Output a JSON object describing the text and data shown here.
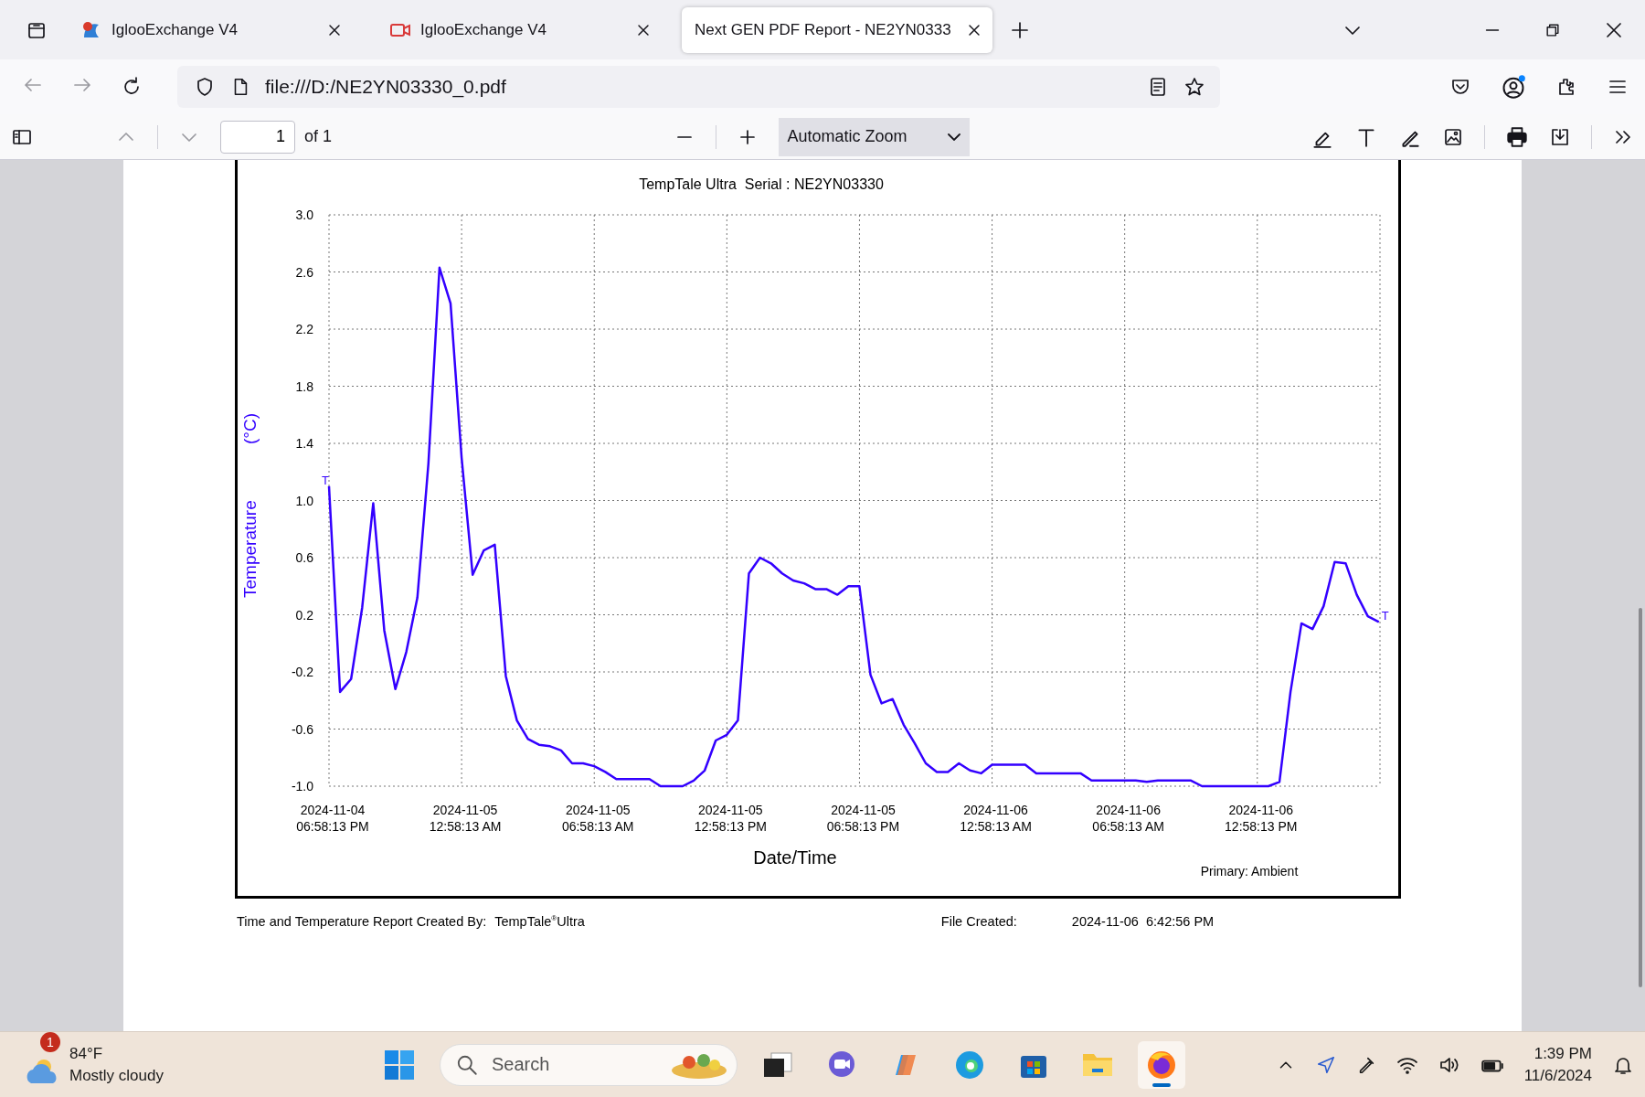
{
  "browser": {
    "tabs": [
      {
        "title": "IglooExchange V4",
        "kind": "logo",
        "selected": false
      },
      {
        "title": "IglooExchange V4",
        "kind": "video",
        "selected": false
      },
      {
        "title": "Next GEN PDF Report - NE2YN0333",
        "kind": "none",
        "selected": true
      }
    ],
    "address_bar": {
      "url": "file:///D:/NE2YN03330_0.pdf"
    }
  },
  "pdf_toolbar": {
    "page_number": "1",
    "page_count": "of 1",
    "zoom": "Automatic Zoom"
  },
  "report": {
    "chart_data": {
      "type": "line",
      "title": "TempTale Ultra  Serial : NE2YN03330",
      "xlabel": "Date/Time",
      "ylabel": "Temperature (°C)",
      "categories": [
        "2024-11-04 06:58:13 PM",
        null,
        null,
        null,
        null,
        null,
        null,
        null,
        null,
        null,
        null,
        null,
        "2024-11-05 12:58:13 AM",
        null,
        null,
        null,
        null,
        null,
        null,
        null,
        null,
        null,
        null,
        null,
        "2024-11-05 06:58:13 AM",
        null,
        null,
        null,
        null,
        null,
        null,
        null,
        null,
        null,
        null,
        null,
        "2024-11-05 12:58:13 PM",
        null,
        null,
        null,
        null,
        null,
        null,
        null,
        null,
        null,
        null,
        null,
        "2024-11-05 06:58:13 PM",
        null,
        null,
        null,
        null,
        null,
        null,
        null,
        null,
        null,
        null,
        null,
        "2024-11-06 12:58:13 AM",
        null,
        null,
        null,
        null,
        null,
        null,
        null,
        null,
        null,
        null,
        null,
        "2024-11-06 06:58:13 AM",
        null,
        null,
        null,
        null,
        null,
        null,
        null,
        null,
        null,
        null,
        null,
        "2024-11-06 12:58:13 PM",
        null,
        null,
        null,
        null,
        null,
        null,
        null,
        null,
        null,
        null,
        null
      ],
      "series": [
        {
          "name": "Primary: Ambient",
          "color": "#3300ff",
          "values": [
            1.1,
            -0.34,
            -0.25,
            0.25,
            0.98,
            0.09,
            -0.32,
            -0.06,
            0.32,
            1.26,
            2.63,
            2.38,
            1.3,
            0.48,
            0.65,
            0.69,
            -0.23,
            -0.54,
            -0.67,
            -0.71,
            -0.72,
            -0.75,
            -0.84,
            -0.84,
            -0.86,
            -0.9,
            -0.95,
            -0.95,
            -0.95,
            -0.95,
            -1,
            -1,
            -1,
            -0.96,
            -0.89,
            -0.68,
            -0.64,
            -0.54,
            0.49,
            0.6,
            0.56,
            0.49,
            0.44,
            0.42,
            0.38,
            0.38,
            0.34,
            0.4,
            0.4,
            -0.22,
            -0.42,
            -0.39,
            -0.57,
            -0.7,
            -0.84,
            -0.9,
            -0.9,
            -0.84,
            -0.89,
            -0.91,
            -0.85,
            -0.85,
            -0.85,
            -0.85,
            -0.91,
            -0.91,
            -0.91,
            -0.91,
            -0.91,
            -0.96,
            -0.96,
            -0.96,
            -0.96,
            -0.96,
            -0.97,
            -0.96,
            -0.96,
            -0.96,
            -0.96,
            -1,
            -1,
            -1,
            -1,
            -1,
            -1,
            -1,
            -0.97,
            -0.34,
            0.14,
            0.1,
            0.26,
            0.57,
            0.56,
            0.34,
            0.19,
            0.15
          ]
        }
      ],
      "ylim": [
        -1,
        3
      ],
      "yticks": [
        {
          "value": 3,
          "label": "3.0"
        },
        {
          "value": 2.6,
          "label": "2.6"
        },
        {
          "value": 2.2,
          "label": "2.2"
        },
        {
          "value": 1.8,
          "label": "1.8"
        },
        {
          "value": 1.4,
          "label": "1.4"
        },
        {
          "value": 1,
          "label": "1.0"
        },
        {
          "value": 0.6,
          "label": "0.6"
        },
        {
          "value": 0.2,
          "label": "0.2"
        },
        {
          "value": -0.2,
          "label": "-0.2"
        },
        {
          "value": -0.6,
          "label": "-0.6"
        },
        {
          "value": -1,
          "label": "-1.0"
        }
      ],
      "grid": true,
      "annotations": [
        "T",
        "T"
      ]
    },
    "footer": {
      "created_by_label": "Time and Temperature Report Created By:",
      "created_by": "TempTale$^{®}$Ultra",
      "file_created_label": "File Created:",
      "file_created": "2024-11-06  6:42:56 PM"
    }
  },
  "taskbar": {
    "weather": {
      "badge": "1",
      "temperature": "84°F",
      "condition": "Mostly cloudy"
    },
    "search": {
      "placeholder": "Search"
    },
    "clock": {
      "time": "1:39 PM",
      "date": "11/6/2024"
    }
  }
}
